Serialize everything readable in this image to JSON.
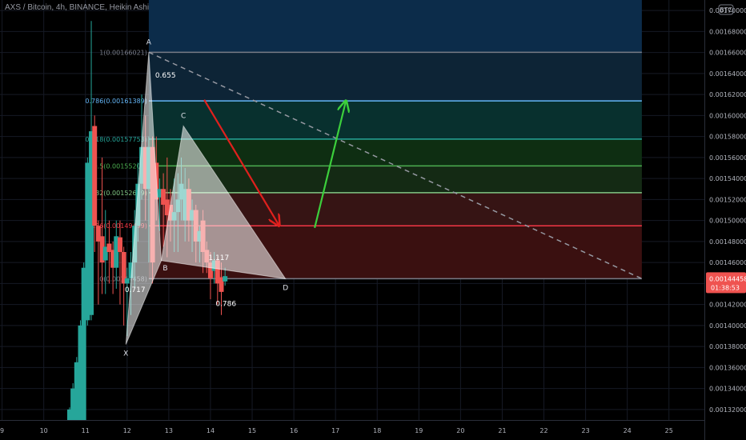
{
  "header": {
    "title": "AXS / Bitcoin, 4h, BINANCE, Heikin Ashi"
  },
  "currency_badge": "BTC",
  "price_box": {
    "price": "0.00144458",
    "countdown": "01:38:53",
    "color": "#ef5350"
  },
  "colors": {
    "bull": "#26a69a",
    "bear": "#ef5350",
    "grid": "#161a25",
    "axis_text": "#b2b5be",
    "harmonic_fill": "#ffffff",
    "arrow_down": "#e0201d",
    "arrow_up": "#3ccf3c",
    "trendline": "#9598a1"
  },
  "chart_data": {
    "type": "candlestick",
    "title": "AXS / Bitcoin, 4h, BINANCE, Heikin Ashi",
    "x_ticks": [
      "9",
      "10",
      "11",
      "12",
      "13",
      "14",
      "15",
      "16",
      "17",
      "18",
      "19",
      "20",
      "21",
      "22",
      "23",
      "24",
      "25"
    ],
    "x_tick_values": [
      9,
      10,
      11,
      12,
      13,
      14,
      15,
      16,
      17,
      18,
      19,
      20,
      21,
      22,
      23,
      24,
      25
    ],
    "xlim": [
      8.95,
      25.85
    ],
    "ylim": [
      0.00131,
      0.00171
    ],
    "y_ticks": [
      "0.00132000",
      "0.00134000",
      "0.00136000",
      "0.00138000",
      "0.00140000",
      "0.00142000",
      "0.00144000",
      "0.00146000",
      "0.00148000",
      "0.00150000",
      "0.00152000",
      "0.00154000",
      "0.00156000",
      "0.00158000",
      "0.00160000",
      "0.00162000",
      "0.00164000",
      "0.00166000",
      "0.00168000",
      "0.00170000"
    ],
    "y_tick_values": [
      0.00132,
      0.00134,
      0.00136,
      0.00138,
      0.0014,
      0.00142,
      0.00144,
      0.00146,
      0.00148,
      0.0015,
      0.00152,
      0.00154,
      0.00156,
      0.00158,
      0.0016,
      0.00162,
      0.00164,
      0.00166,
      0.00168,
      0.0017
    ],
    "candles": [
      {
        "t": 10.62,
        "o": 0.00131,
        "h": 0.001322,
        "l": 0.001305,
        "c": 0.00132
      },
      {
        "t": 10.7,
        "o": 0.00131,
        "h": 0.001345,
        "l": 0.001305,
        "c": 0.00134
      },
      {
        "t": 10.79,
        "o": 0.00131,
        "h": 0.00137,
        "l": 0.001305,
        "c": 0.001365
      },
      {
        "t": 10.88,
        "o": 0.00131,
        "h": 0.001405,
        "l": 0.001305,
        "c": 0.0014
      },
      {
        "t": 10.96,
        "o": 0.00131,
        "h": 0.00146,
        "l": 0.001305,
        "c": 0.001455
      },
      {
        "t": 11.05,
        "o": 0.001405,
        "h": 0.00156,
        "l": 0.0014,
        "c": 0.001555
      },
      {
        "t": 11.14,
        "o": 0.00141,
        "h": 0.00169,
        "l": 0.001405,
        "c": 0.001585
      },
      {
        "t": 11.22,
        "o": 0.00159,
        "h": 0.0016,
        "l": 0.00147,
        "c": 0.001495
      },
      {
        "t": 11.31,
        "o": 0.001495,
        "h": 0.0015,
        "l": 0.00142,
        "c": 0.00148
      },
      {
        "t": 11.4,
        "o": 0.001485,
        "h": 0.00156,
        "l": 0.00143,
        "c": 0.00146
      },
      {
        "t": 11.48,
        "o": 0.001462,
        "h": 0.00151,
        "l": 0.00143,
        "c": 0.001475
      },
      {
        "t": 11.57,
        "o": 0.001478,
        "h": 0.0015,
        "l": 0.00144,
        "c": 0.00147
      },
      {
        "t": 11.66,
        "o": 0.001472,
        "h": 0.00148,
        "l": 0.00143,
        "c": 0.001455
      },
      {
        "t": 11.74,
        "o": 0.001455,
        "h": 0.0015,
        "l": 0.001435,
        "c": 0.001485
      },
      {
        "t": 11.83,
        "o": 0.001484,
        "h": 0.0015,
        "l": 0.00142,
        "c": 0.00147
      },
      {
        "t": 11.92,
        "o": 0.00147,
        "h": 0.001475,
        "l": 0.0014,
        "c": 0.00144
      },
      {
        "t": 12.0,
        "o": 0.00144,
        "h": 0.001455,
        "l": 0.00139,
        "c": 0.001445
      },
      {
        "t": 12.09,
        "o": 0.001445,
        "h": 0.00147,
        "l": 0.00141,
        "c": 0.00146
      },
      {
        "t": 12.18,
        "o": 0.00146,
        "h": 0.00151,
        "l": 0.001435,
        "c": 0.001495
      },
      {
        "t": 12.26,
        "o": 0.001495,
        "h": 0.001555,
        "l": 0.00148,
        "c": 0.001535
      },
      {
        "t": 12.35,
        "o": 0.001535,
        "h": 0.00162,
        "l": 0.00152,
        "c": 0.00157
      },
      {
        "t": 12.44,
        "o": 0.00157,
        "h": 0.0016,
        "l": 0.0015,
        "c": 0.00153
      },
      {
        "t": 12.52,
        "o": 0.00153,
        "h": 0.00158,
        "l": 0.00146,
        "c": 0.00157
      },
      {
        "t": 12.61,
        "o": 0.00157,
        "h": 0.00158,
        "l": 0.00144,
        "c": 0.00146
      },
      {
        "t": 12.7,
        "o": 0.001555,
        "h": 0.00158,
        "l": 0.0015,
        "c": 0.00152
      },
      {
        "t": 12.78,
        "o": 0.001522,
        "h": 0.00154,
        "l": 0.00149,
        "c": 0.00153
      },
      {
        "t": 12.87,
        "o": 0.00153,
        "h": 0.001545,
        "l": 0.001475,
        "c": 0.001515
      },
      {
        "t": 12.96,
        "o": 0.00152,
        "h": 0.00156,
        "l": 0.001465,
        "c": 0.001505
      },
      {
        "t": 13.04,
        "o": 0.001515,
        "h": 0.00153,
        "l": 0.00148,
        "c": 0.0015
      },
      {
        "t": 13.13,
        "o": 0.0015,
        "h": 0.00154,
        "l": 0.00147,
        "c": 0.001508
      },
      {
        "t": 13.22,
        "o": 0.001508,
        "h": 0.001545,
        "l": 0.00147,
        "c": 0.00152
      },
      {
        "t": 13.3,
        "o": 0.00152,
        "h": 0.00156,
        "l": 0.0015,
        "c": 0.001535
      },
      {
        "t": 13.39,
        "o": 0.0015,
        "h": 0.00155,
        "l": 0.00148,
        "c": 0.00153
      },
      {
        "t": 13.48,
        "o": 0.00153,
        "h": 0.00154,
        "l": 0.00148,
        "c": 0.0015
      },
      {
        "t": 13.56,
        "o": 0.0015,
        "h": 0.00152,
        "l": 0.00147,
        "c": 0.00151
      },
      {
        "t": 13.65,
        "o": 0.00151,
        "h": 0.001515,
        "l": 0.00146,
        "c": 0.00148
      },
      {
        "t": 13.74,
        "o": 0.00148,
        "h": 0.001495,
        "l": 0.00146,
        "c": 0.00149
      },
      {
        "t": 13.82,
        "o": 0.0015,
        "h": 0.00151,
        "l": 0.00145,
        "c": 0.00147
      },
      {
        "t": 13.91,
        "o": 0.001472,
        "h": 0.00148,
        "l": 0.00145,
        "c": 0.00146
      },
      {
        "t": 14.0,
        "o": 0.00146,
        "h": 0.00147,
        "l": 0.001425,
        "c": 0.001445
      },
      {
        "t": 14.09,
        "o": 0.001452,
        "h": 0.00147,
        "l": 0.00144,
        "c": 0.001462
      },
      {
        "t": 14.17,
        "o": 0.001462,
        "h": 0.001465,
        "l": 0.00142,
        "c": 0.00144
      },
      {
        "t": 14.26,
        "o": 0.001446,
        "h": 0.00146,
        "l": 0.00141,
        "c": 0.001432
      },
      {
        "t": 14.35,
        "o": 0.001442,
        "h": 0.001455,
        "l": 0.001438,
        "c": 0.001447
      }
    ],
    "harmonic_pattern": {
      "name": "XABCD",
      "points": [
        {
          "label": "X",
          "t": 11.97,
          "price": 0.001382
        },
        {
          "label": "A",
          "t": 12.52,
          "price": 0.0016602
        },
        {
          "label": "B",
          "t": 12.82,
          "price": 0.0014618
        },
        {
          "label": "C",
          "t": 13.35,
          "price": 0.00159
        },
        {
          "label": "D",
          "t": 15.8,
          "price": 0.0014445
        }
      ],
      "ratios": [
        {
          "text": "0.655",
          "t": 12.92,
          "price": 0.001636
        },
        {
          "text": "0.717",
          "t": 12.19,
          "price": 0.0014318
        },
        {
          "text": "0.786",
          "t": 14.37,
          "price": 0.0014185
        },
        {
          "text": "1.117",
          "t": 14.2,
          "price": 0.0014622
        }
      ]
    },
    "fib_retracement": {
      "t_start": 12.52,
      "t_end": 24.35,
      "levels": [
        {
          "ratio": "1",
          "price": 0.00166021,
          "label": "1(0.00166021)",
          "color": "#787b86",
          "fill": "#2a2a2e"
        },
        {
          "ratio": "0.786",
          "price": 0.00161389,
          "label": "0.786(0.00161389)",
          "color": "#64b5f6",
          "fill": "#0d2436"
        },
        {
          "ratio": "0.618",
          "price": 0.00157753,
          "label": "0.618(0.00157753)",
          "color": "#26a69a",
          "fill": "#08302e"
        },
        {
          "ratio": "0.5",
          "price": 0.00155201,
          "label": "0.5(0.00155201)",
          "color": "#4caf50",
          "fill": "#0e2e12"
        },
        {
          "ratio": "0.382",
          "price": 0.00152649,
          "label": "0.382(0.00152649)",
          "color": "#81c784",
          "fill": "#142a14"
        },
        {
          "ratio": "0.236",
          "price": 0.00149499,
          "label": "0.236(0.00149499)",
          "color": "#f23645",
          "fill": "#361414"
        },
        {
          "ratio": "0",
          "price": 0.00144458,
          "label": "0(0.00144458)",
          "color": "#787b86",
          "fill": "#3a1010"
        }
      ],
      "upper_zone": {
        "price_top": 0.00171,
        "color": "#0c2c4a"
      }
    },
    "trendline": {
      "t1": 12.52,
      "p1": 0.00166021,
      "t2": 24.35,
      "p2": 0.00144458,
      "style": "dashed"
    },
    "arrows": [
      {
        "direction": "down",
        "t1": 13.85,
        "p1": 0.001615,
        "t2": 15.65,
        "p2": 0.001495
      },
      {
        "direction": "up",
        "t1": 16.5,
        "p1": 0.001493,
        "t2": 17.25,
        "p2": 0.001614
      }
    ]
  }
}
